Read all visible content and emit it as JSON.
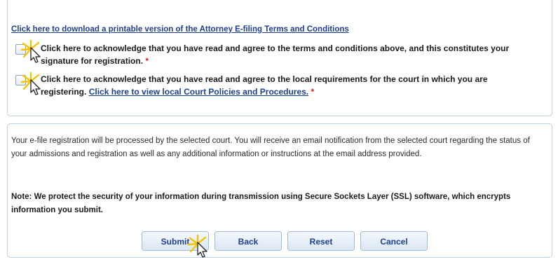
{
  "download_link": "Click here to download a printable version of the Attorney E-filing Terms and Conditions",
  "ack_terms": {
    "line1": "Click here to acknowledge that you have read and agree to the terms and conditions above, and this constitutes your",
    "line2": "signature for registration.",
    "required_mark": "*"
  },
  "ack_local": {
    "line1": "Click here to acknowledge that you have read and agree to the local requirements for the court in which you are",
    "line2_prefix": "registering.",
    "link": "Click here to view local Court Policies and Procedures.",
    "required_mark": "*"
  },
  "info_paragraph": "Your e-file registration will be processed by the selected court. You will receive an email notification from the selected court regarding the status of your admissions and registration as well as any additional information or instructions at the email address provided.",
  "note_paragraph": "Note: We protect the security of your information during transmission using Secure Sockets Layer (SSL) software, which encrypts information you submit.",
  "buttons": {
    "submit": "Submit",
    "back": "Back",
    "reset": "Reset",
    "cancel": "Cancel"
  },
  "colors": {
    "link": "#1d3f8f",
    "required": "#d11c1c",
    "panel_border": "#bcd0e4",
    "button_top": "#f4f8fc",
    "button_bottom": "#dbe7f3",
    "highlight": "#f5c400"
  },
  "icons": [
    "click-highlight-cursor-icon"
  ]
}
